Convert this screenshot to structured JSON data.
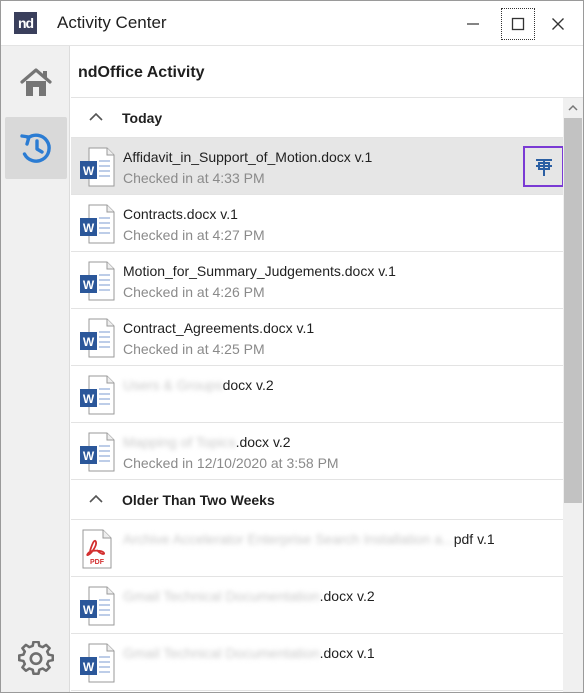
{
  "window": {
    "logo_text": "nd",
    "title": "Activity Center"
  },
  "main": {
    "title": "ndOffice Activity"
  },
  "groups": [
    {
      "label": "Today",
      "items": [
        {
          "name": "Affidavit_in_Support_of_Motion.docx v.1",
          "sub": "Checked in at 4:33 PM",
          "type": "word",
          "selected": true
        },
        {
          "name": "Contracts.docx v.1",
          "sub": "Checked in at 4:27 PM",
          "type": "word"
        },
        {
          "name": "Motion_for_Summary_Judgements.docx v.1",
          "sub": "Checked in at 4:26 PM",
          "type": "word"
        },
        {
          "name": "Contract_Agreements.docx v.1",
          "sub": "Checked in at 4:25 PM",
          "type": "word"
        },
        {
          "name_blurred": "Users & Groups",
          "name_suffix": "docx v.2",
          "sub": "",
          "type": "word"
        },
        {
          "name_blurred": "Mapping of Topics",
          "name_suffix": ".docx v.2",
          "sub": "Checked in 12/10/2020 at 3:58 PM",
          "type": "word"
        }
      ]
    },
    {
      "label": "Older Than Two Weeks",
      "items": [
        {
          "name_blurred": "Archive Accelerator Enterprise Search Installation a...",
          "name_suffix": "pdf v.1",
          "sub": "",
          "type": "pdf"
        },
        {
          "name_blurred": "Gmail Technical Documentation",
          "name_suffix": ".docx v.2",
          "sub": "",
          "type": "word"
        },
        {
          "name_blurred": "Gmail Technical Documentation",
          "name_suffix": ".docx v.1",
          "sub": "",
          "type": "word"
        }
      ]
    }
  ],
  "icons": {
    "logo": "nd-logo-icon",
    "minimize": "minimize-icon",
    "maximize": "maximize-icon",
    "close": "close-icon",
    "home": "home-icon",
    "activity": "activity-history-icon",
    "settings": "gear-icon",
    "pin": "pin-icon",
    "word": "word-document-icon",
    "pdf": "pdf-document-icon",
    "chevron": "chevron-up-icon"
  },
  "colors": {
    "accent": "#2b7cd3",
    "selected_row": "#e6e6e6",
    "pin_border": "#7a3ad4",
    "word_blue": "#2b579a",
    "pdf_red": "#d32f2f"
  }
}
